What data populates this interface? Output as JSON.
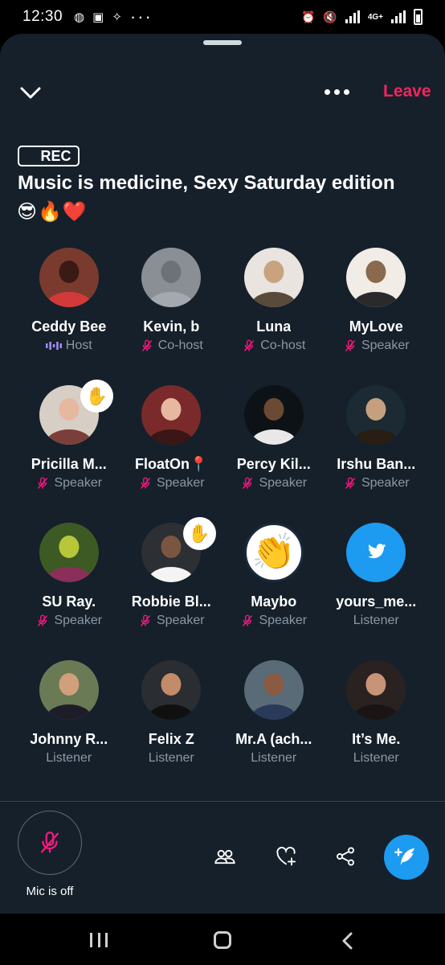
{
  "status_bar": {
    "time": "12:30",
    "network": "4G+"
  },
  "header": {
    "leave_label": "Leave"
  },
  "space": {
    "rec_label": "REC",
    "title": "Music is medicine, Sexy Saturday edition",
    "title_emojis": "😎🔥❤️"
  },
  "participants": [
    {
      "name": "Ceddy Bee",
      "role": "Host",
      "role_icon": "host-audio-icon",
      "hand_raised": false
    },
    {
      "name": "Kevin, b",
      "role": "Co-host",
      "role_icon": "mic-off-icon",
      "hand_raised": false
    },
    {
      "name": "Luna",
      "role": "Co-host",
      "role_icon": "mic-off-icon",
      "hand_raised": false
    },
    {
      "name": "MyLove",
      "role": "Speaker",
      "role_icon": "mic-off-icon",
      "hand_raised": false
    },
    {
      "name": "Pricilla M...",
      "role": "Speaker",
      "role_icon": "mic-off-icon",
      "hand_raised": true,
      "reaction": "✋"
    },
    {
      "name": "FloatOn📍",
      "role": "Speaker",
      "role_icon": "mic-off-icon",
      "hand_raised": false
    },
    {
      "name": "Percy Kil...",
      "role": "Speaker",
      "role_icon": "mic-off-icon",
      "hand_raised": false
    },
    {
      "name": "Irshu Ban...",
      "role": "Speaker",
      "role_icon": "mic-off-icon",
      "hand_raised": false
    },
    {
      "name": "SU Ray.",
      "role": "Speaker",
      "role_icon": "mic-off-icon",
      "hand_raised": false
    },
    {
      "name": "Robbie Bl...",
      "role": "Speaker",
      "role_icon": "mic-off-icon",
      "hand_raised": true,
      "reaction": "✋"
    },
    {
      "name": "Maybo",
      "role": "Speaker",
      "role_icon": "mic-off-icon",
      "hand_raised": false,
      "avatar_emoji": "👏"
    },
    {
      "name": "yours_me...",
      "role": "Listener",
      "role_icon": "",
      "hand_raised": false,
      "avatar_logo": "twitter-bird-icon"
    },
    {
      "name": "Johnny R...",
      "role": "Listener",
      "role_icon": "",
      "hand_raised": false
    },
    {
      "name": "Felix Z",
      "role": "Listener",
      "role_icon": "",
      "hand_raised": false
    },
    {
      "name": "Mr.A (ach...",
      "role": "Listener",
      "role_icon": "",
      "hand_raised": false
    },
    {
      "name": "It’s Me.",
      "role": "Listener",
      "role_icon": "",
      "hand_raised": false
    }
  ],
  "bottom_bar": {
    "mic_label": "Mic is off",
    "tools": [
      "people-icon",
      "heart-plus-icon",
      "share-icon",
      "compose-icon"
    ]
  },
  "colors": {
    "background": "#15202b",
    "accent": "#1d9bf0",
    "leave": "#f4245e",
    "host_icon": "#a48cf2",
    "muted_icon": "#f91880",
    "secondary_text": "#8b98a5"
  }
}
